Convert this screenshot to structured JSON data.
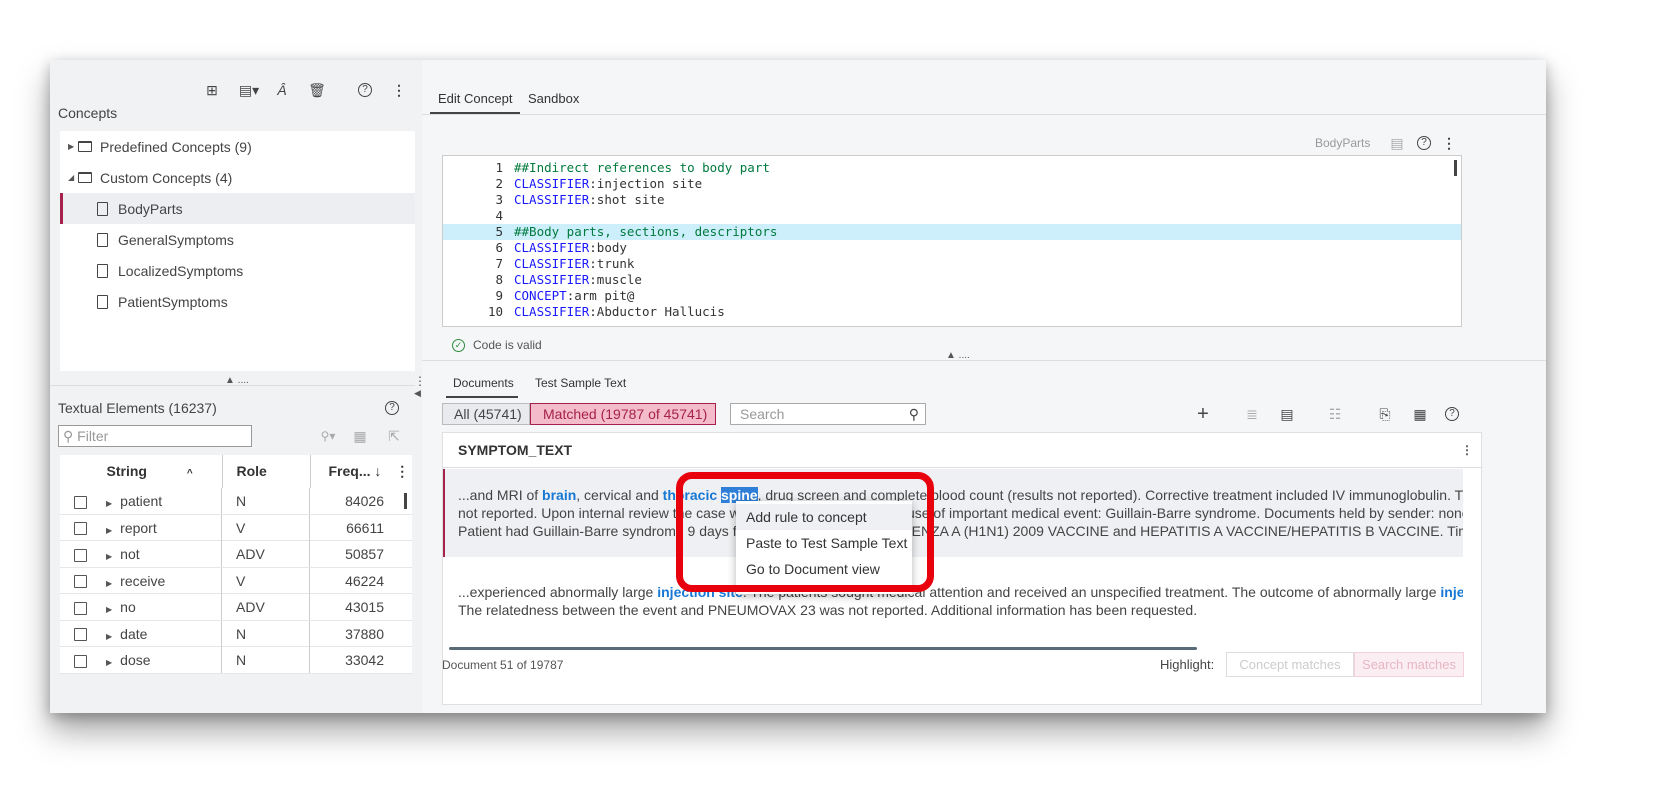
{
  "concepts_panel": {
    "title": "Concepts",
    "toolbar_icons": [
      "new-concept-icon",
      "new-file-dropdown-icon",
      "rename-icon",
      "delete-icon",
      "help-icon",
      "more-icon"
    ],
    "tree": {
      "predefined": "Predefined Concepts (9)",
      "custom": "Custom Concepts (4)",
      "items": [
        "BodyParts",
        "GeneralSymptoms",
        "LocalizedSymptoms",
        "PatientSymptoms"
      ],
      "selected": "BodyParts"
    },
    "splitter": "▲ ...."
  },
  "textual_elements": {
    "title": "Textual Elements (16237)",
    "filter_placeholder": "Filter",
    "columns": [
      "String",
      "Role",
      "Freq... ↓"
    ],
    "rows": [
      {
        "string": "patient",
        "role": "N",
        "freq": "84026"
      },
      {
        "string": "report",
        "role": "V",
        "freq": "66611"
      },
      {
        "string": "not",
        "role": "ADV",
        "freq": "50857"
      },
      {
        "string": "receive",
        "role": "V",
        "freq": "46224"
      },
      {
        "string": "no",
        "role": "ADV",
        "freq": "43015"
      },
      {
        "string": "date",
        "role": "N",
        "freq": "37880"
      },
      {
        "string": "dose",
        "role": "N",
        "freq": "33042"
      }
    ]
  },
  "editor": {
    "tabs": [
      "Edit Concept",
      "Sandbox"
    ],
    "active_tab": "Edit Concept",
    "concept_name": "BodyParts",
    "lines": [
      {
        "n": "1",
        "kw": "",
        "text": "##Indirect references to body part"
      },
      {
        "n": "2",
        "kw": "CLASSIFIER",
        "text": ":injection site"
      },
      {
        "n": "3",
        "kw": "CLASSIFIER",
        "text": ":shot site"
      },
      {
        "n": "4",
        "kw": "",
        "text": ""
      },
      {
        "n": "5",
        "kw": "",
        "text": "##Body parts, sections, descriptors"
      },
      {
        "n": "6",
        "kw": "CLASSIFIER",
        "text": ":body"
      },
      {
        "n": "7",
        "kw": "CLASSIFIER",
        "text": ":trunk"
      },
      {
        "n": "8",
        "kw": "CLASSIFIER",
        "text": ":muscle"
      },
      {
        "n": "9",
        "kw": "CONCEPT",
        "text": ":arm pit@"
      },
      {
        "n": "10",
        "kw": "CLASSIFIER",
        "text": ":Abductor Hallucis"
      }
    ],
    "validation": "Code is valid",
    "splitter": "▲ ...."
  },
  "documents": {
    "tabs": [
      "Documents",
      "Test Sample Text"
    ],
    "active_tab": "Documents",
    "filter_all": "All (45741)",
    "filter_matched": "Matched (19787 of 45741)",
    "search_placeholder": "Search",
    "column_header": "SYMPTOM_TEXT",
    "doc1": {
      "l1_a": "...and MRI of ",
      "l1_brain": "brain",
      "l1_b": ", cervical and ",
      "l1_thoracic": "thoracic",
      "l1_sp": " ",
      "l1_spine": "spine",
      "l1_c": ", drug screen and complete blood count (results not reported). Corrective treatment included IV immunoglobulin. The ou",
      "l2": "not reported. Upon internal review the case w                                           use of important medical event: Guillain-Barre syndrome. Documents held by sender: none",
      "l3": "Patient had Guillain-Barre syndrome 9 days fo                                           ENZA A (H1N1) 2009 VACCINE and HEPATITIS A VACCINE/HEPATITIS B VACCINE. Time to c"
    },
    "doc2": {
      "l1_a": "...experienced abnormally large ",
      "l1_hl": "injection site",
      "l1_b": ". The patients sought medical attention and received an unspecified treatment. The outcome of abnormally large ",
      "l1_hl2": "injection",
      "l2": "The relatedness between the event and PNEUMOVAX 23 was not reported. Additional information has been requested."
    },
    "status": "Document 51 of 19787",
    "highlight_label": "Highlight:",
    "highlight_concept": "Concept matches",
    "highlight_search": "Search matches"
  },
  "context_menu": {
    "items": [
      "Add rule to concept",
      "Paste to Test Sample Text",
      "Go to Document view"
    ]
  },
  "colors": {
    "accent": "#a6214c",
    "keyword": "#1a1aff",
    "comment": "#007a3d",
    "highlight": "#1778d4",
    "callout": "#e8000c"
  }
}
